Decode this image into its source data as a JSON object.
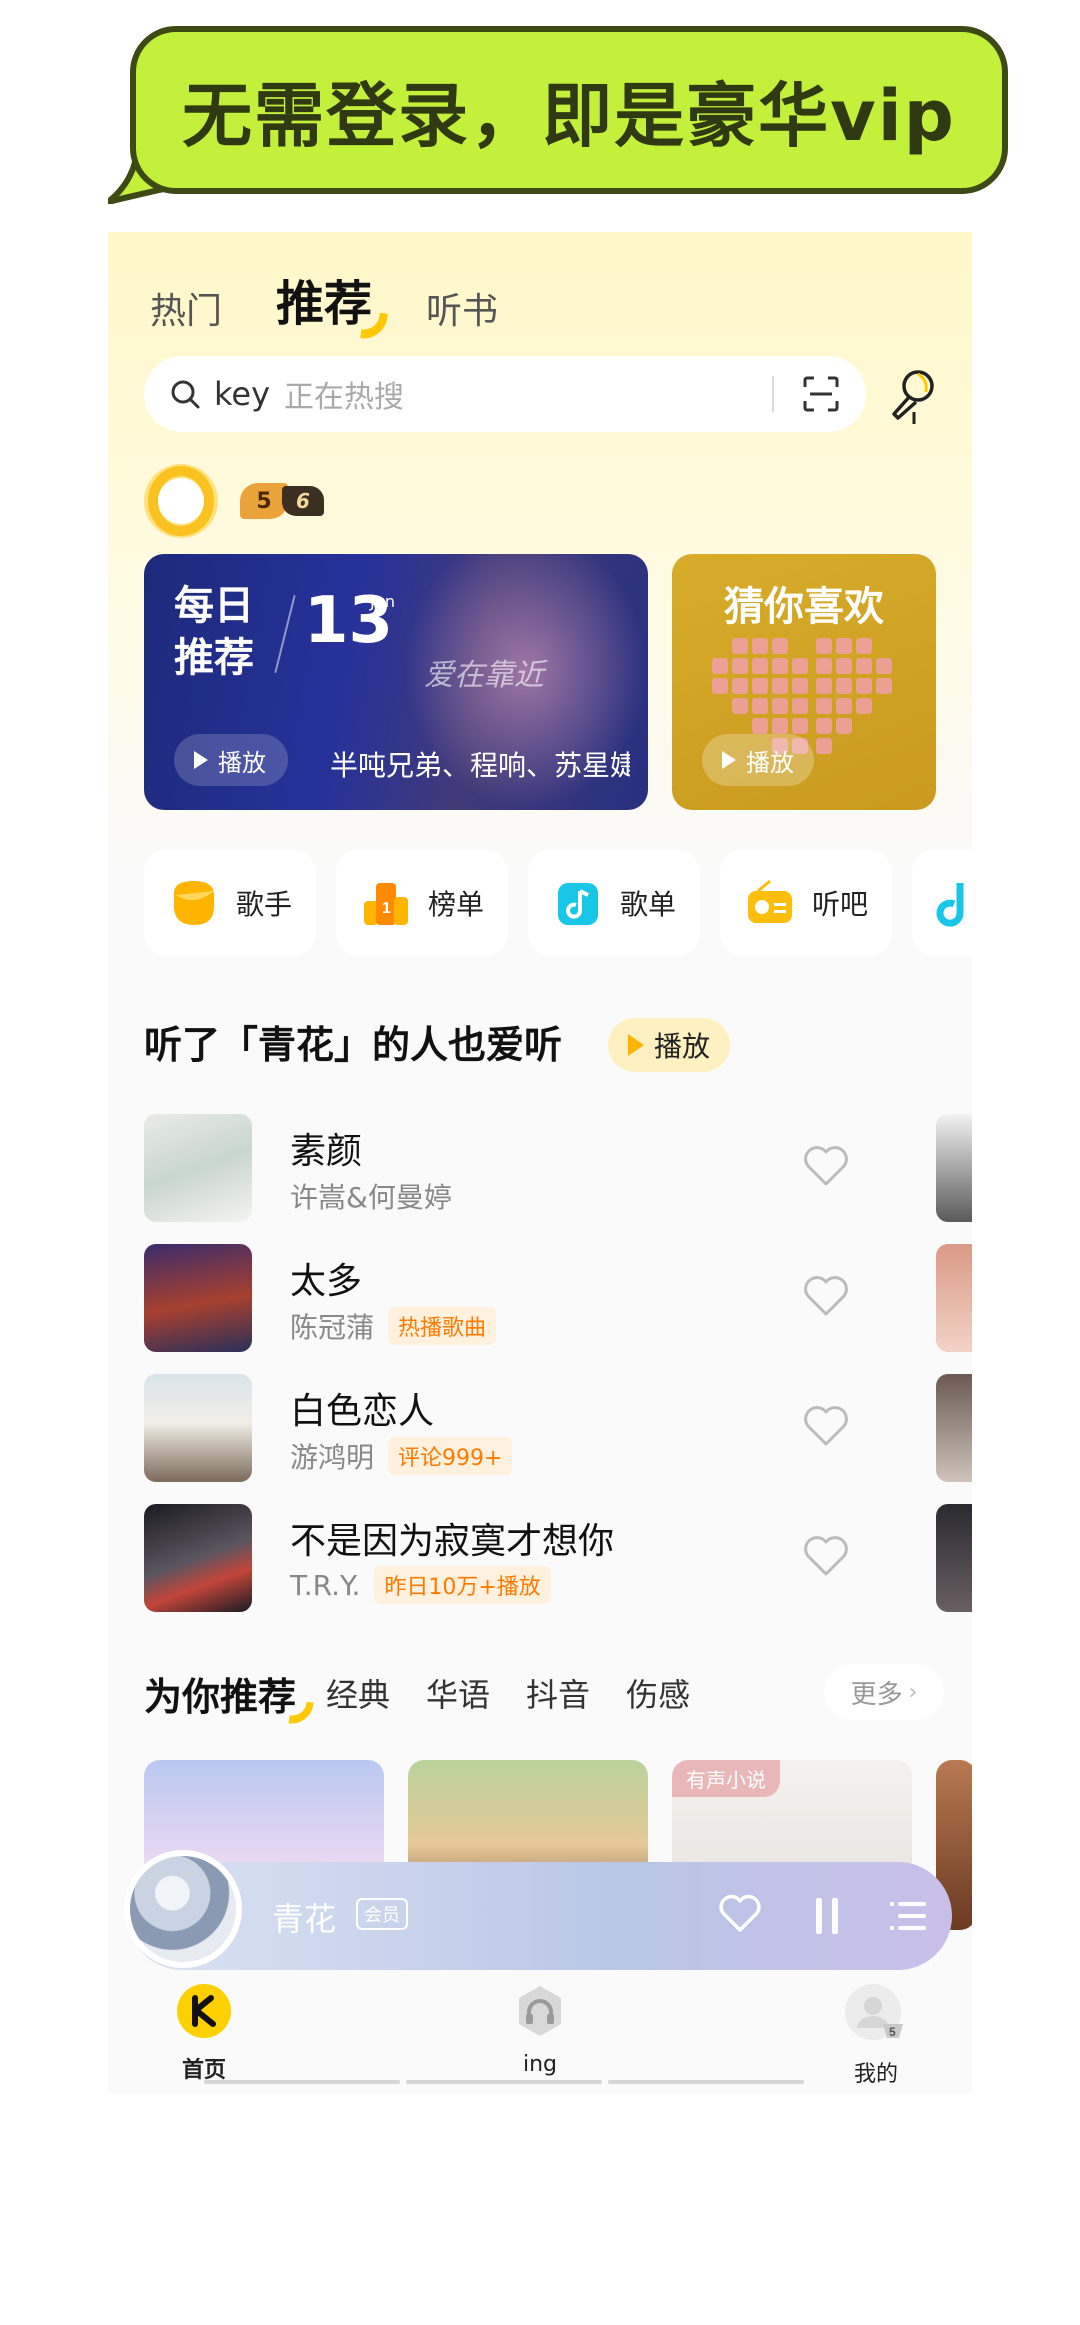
{
  "banner": {
    "text": "无需登录，即是豪华vip"
  },
  "top_tabs": [
    {
      "label": "热门",
      "active": false
    },
    {
      "label": "推荐",
      "active": true
    },
    {
      "label": "听书",
      "active": false
    }
  ],
  "search": {
    "keyword": "key",
    "hint": "正在热搜"
  },
  "user": {
    "level_a": "5",
    "level_b": "6"
  },
  "daily_card": {
    "title": "每日推荐",
    "day": "13",
    "month": "Jun",
    "overlay": "爱在靠近",
    "play_label": "播放",
    "artists": "半吨兄弟、程响、苏星婕"
  },
  "guess_card": {
    "title": "猜你喜欢",
    "play_label": "播放"
  },
  "quick_entries": [
    {
      "label": "歌手",
      "icon": "singer-icon",
      "color": "#ffb400"
    },
    {
      "label": "榜单",
      "icon": "chart-icon",
      "color": "#ff8a00"
    },
    {
      "label": "歌单",
      "icon": "playlist-icon",
      "color": "#18c7e8"
    },
    {
      "label": "听吧",
      "icon": "radio-icon",
      "color": "#ffbe0b"
    }
  ],
  "similar_section": {
    "title": "听了「青花」的人也爱听",
    "play_label": "播放"
  },
  "songs": [
    {
      "title": "素颜",
      "artist": "许嵩&何曼婷",
      "tag": ""
    },
    {
      "title": "太多",
      "artist": "陈冠蒲",
      "tag": "热播歌曲"
    },
    {
      "title": "白色恋人",
      "artist": "游鸿明",
      "tag": "评论999+"
    },
    {
      "title": "不是因为寂寞才想你",
      "artist": "T.R.Y.",
      "tag": "昨日10万+播放"
    }
  ],
  "recommend": {
    "title": "为你推荐",
    "tabs": [
      "经典",
      "华语",
      "抖音",
      "伤感"
    ],
    "more_label": "更多",
    "card_badge": "有声小说"
  },
  "player": {
    "title": "青花",
    "badge": "会员"
  },
  "bottom_nav": [
    {
      "label": "首页",
      "active": true
    },
    {
      "label": "ing",
      "active": false
    },
    {
      "label": "我的",
      "active": false
    }
  ],
  "colors": {
    "accent": "#ffc800",
    "banner_green": "#c3f03a",
    "tag_orange": "#ff7a00"
  }
}
